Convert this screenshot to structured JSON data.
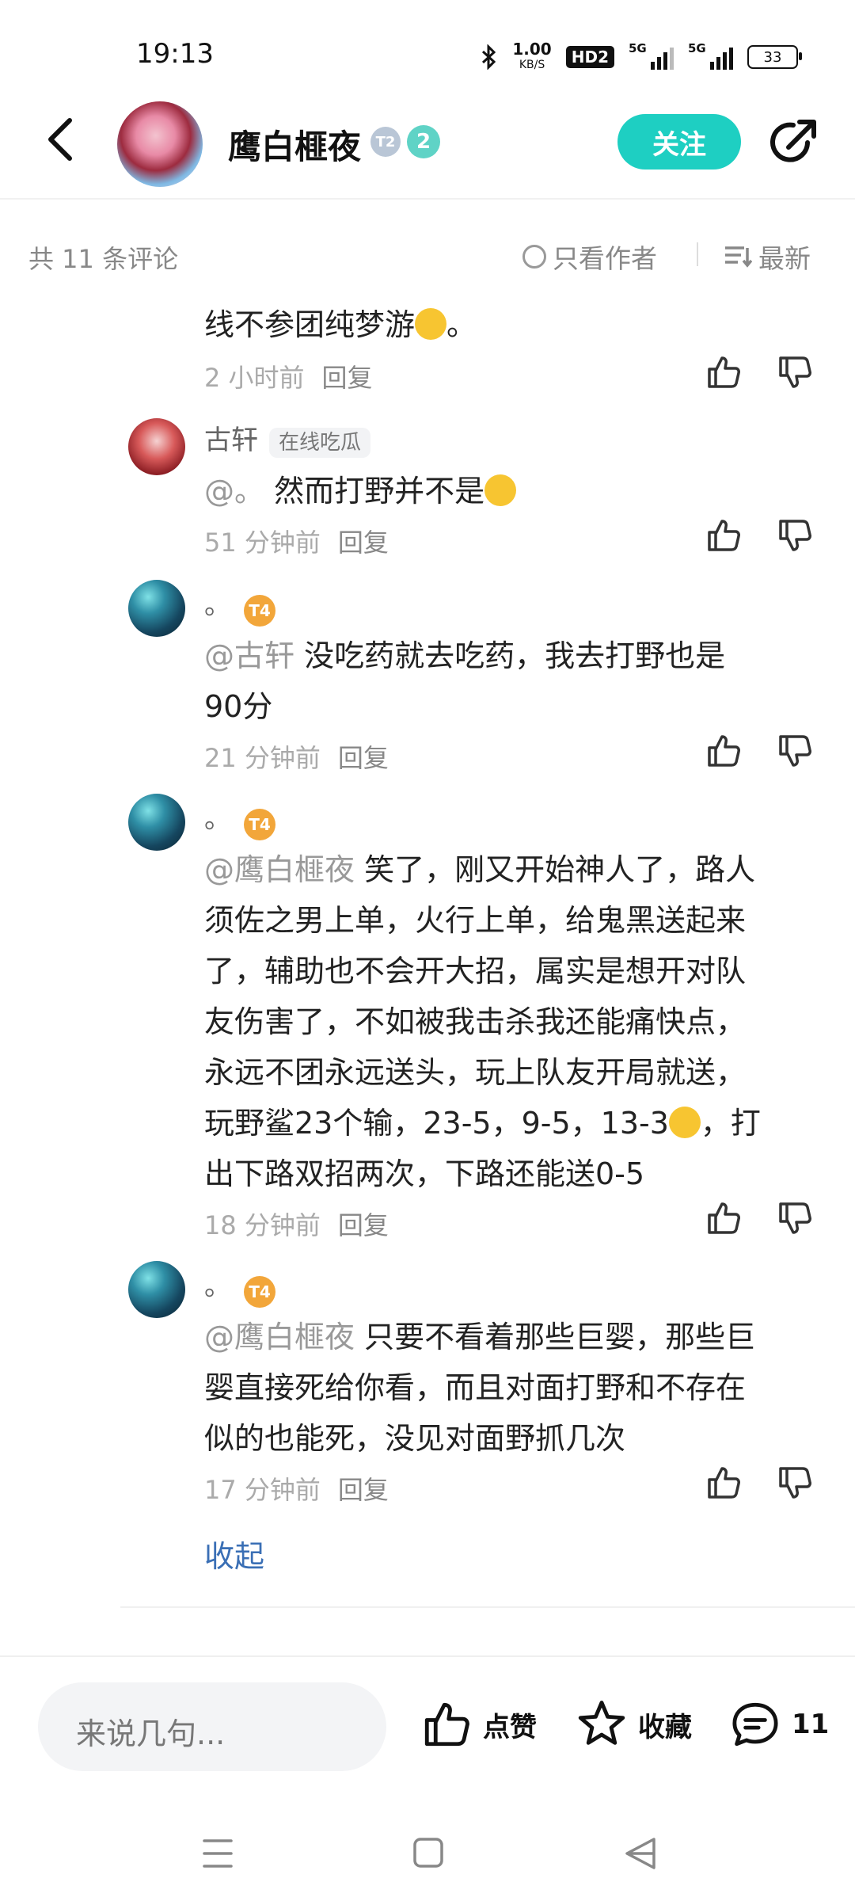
{
  "status": {
    "time": "19:13",
    "speed_value": "1.00",
    "speed_unit": "KB/S",
    "hd": "HD2",
    "sim1": "5G",
    "sim2": "5G",
    "battery": "33"
  },
  "header": {
    "username": "鹰白榧夜",
    "level_badge_1": "T2",
    "level_badge_2": "2",
    "follow_label": "关注"
  },
  "comment_bar": {
    "count": "共 11 条评论",
    "only_author": "只看作者",
    "latest": "最新"
  },
  "comments": [
    {
      "text": "线不参团纯梦游",
      "tail": "。",
      "time": "2 小时前",
      "reply": "回复"
    },
    {
      "name": "古轩",
      "tag": "在线吃瓜",
      "mention": "@。",
      "text": " 然而打野并不是",
      "time": "51 分钟前",
      "reply": "回复"
    },
    {
      "name": "。",
      "badge": "T4",
      "mention": "@古轩",
      "text1": " 没吃药就去吃药，我去打野也是",
      "text2": "90分",
      "time": "21 分钟前",
      "reply": "回复"
    },
    {
      "name": "。",
      "badge": "T4",
      "mention": "@鹰白榧夜",
      "l1": " 笑了，刚又开始神人了，路人",
      "l2": "须佐之男上单，火行上单，给鬼黑送起来",
      "l3": "了，辅助也不会开大招，属实是想开对队",
      "l4": "友伤害了，不如被我击杀我还能痛快点，",
      "l5": "永远不团永远送头，玩上队友开局就送，",
      "l6a": "玩野鲨23个输，23-5，9-5，13-3",
      "l6b": "，打",
      "l7": "出下路双招两次，下路还能送0-5",
      "time": "18 分钟前",
      "reply": "回复"
    },
    {
      "name": "。",
      "badge": "T4",
      "mention": "@鹰白榧夜",
      "l1": " 只要不看着那些巨婴，那些巨",
      "l2": "婴直接死给你看，而且对面打野和不存在",
      "l3": "似的也能死，没见对面野抓几次",
      "time": "17 分钟前",
      "reply": "回复"
    }
  ],
  "collapse_label": "收起",
  "bottom": {
    "input_placeholder": "来说几句...",
    "like_label": "点赞",
    "fav_label": "收藏",
    "comment_count": "11"
  },
  "colors": {
    "accent": "#1ecfc2",
    "link": "#3a6fb5"
  }
}
